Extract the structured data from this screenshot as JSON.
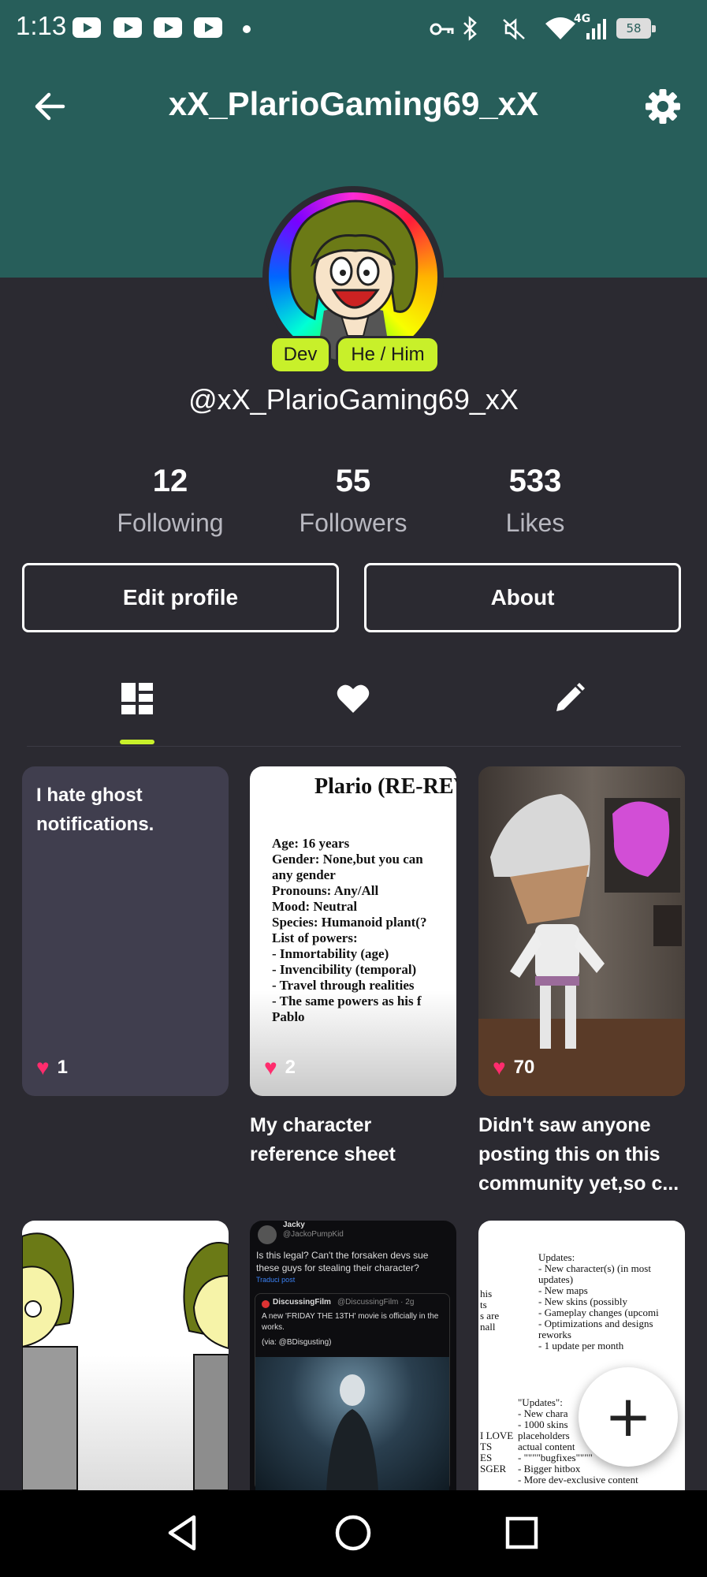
{
  "status_bar": {
    "time": "1:13",
    "network": "4G",
    "battery": "58"
  },
  "header": {
    "title": "xX_PlarioGaming69_xX"
  },
  "profile": {
    "badges": [
      "Dev",
      "He / Him"
    ],
    "handle": "@xX_PlarioGaming69_xX",
    "stats": [
      {
        "value": "12",
        "label": "Following"
      },
      {
        "value": "55",
        "label": "Followers"
      },
      {
        "value": "533",
        "label": "Likes"
      }
    ],
    "buttons": {
      "edit": "Edit profile",
      "about": "About"
    }
  },
  "tabs": [
    {
      "icon": "grid-icon",
      "active": true
    },
    {
      "icon": "heart-icon",
      "active": false
    },
    {
      "icon": "pencil-icon",
      "active": false
    }
  ],
  "posts": [
    {
      "text": "I hate ghost notifications.",
      "likes": "1",
      "caption": ""
    },
    {
      "image_title": "Plario (RE-REV",
      "likes": "2",
      "caption": "My character reference sheet"
    },
    {
      "likes": "70",
      "caption": "Didn't saw anyone posting this on this community yet,so c..."
    }
  ],
  "ref_sheet": [
    "Age: 16 years",
    "Gender: None,but you can",
    "any gender",
    "Pronouns: Any/All",
    "Mood: Neutral",
    "Species: Humanoid plant(?",
    "List of powers:",
    "- Inmortability (age)",
    "- Invencibility (temporal)",
    "- Travel through realities",
    "- The same powers as his f",
    "Pablo"
  ],
  "tweet": {
    "author": "Jacky",
    "user": "@JackoPumpKid",
    "text": "Is this legal? Can't the forsaken devs sue these guys for stealing their character?",
    "translate": "Traduci post",
    "quoted_author": "DiscussingFilm",
    "quoted_handle": "@DiscussingFilm · 2g",
    "quoted_text": "A new 'FRIDAY THE 13TH' movie is officially in the works.",
    "via": "(via: @BDisgusting)"
  },
  "updates_post": {
    "lines": [
      "Updates:",
      "- New character(s) (in most",
      "updates)",
      "- New maps",
      "- New skins (possibly",
      "- Gameplay changes (upcomi",
      "- Optimizations and designs",
      "reworks",
      "- 1 update per month"
    ],
    "lines2": [
      "\"Updates\":",
      "- New chara",
      "- 1000 skins",
      "placeholders",
      "actual content",
      "- \"\"\"\"bugfixes\"\"\"\"",
      "- Bigger hitbox",
      "- More dev-exclusive content"
    ],
    "left_fragments": [
      "his",
      "ts",
      "s are",
      "nall",
      "I LOVE",
      "TS",
      "ES",
      "SGER"
    ]
  },
  "fab": {
    "label": "+"
  },
  "colors": {
    "header": "#275e5a",
    "background": "#2b2a31",
    "accent": "#c8f02a",
    "heart": "#ff2c6d"
  }
}
